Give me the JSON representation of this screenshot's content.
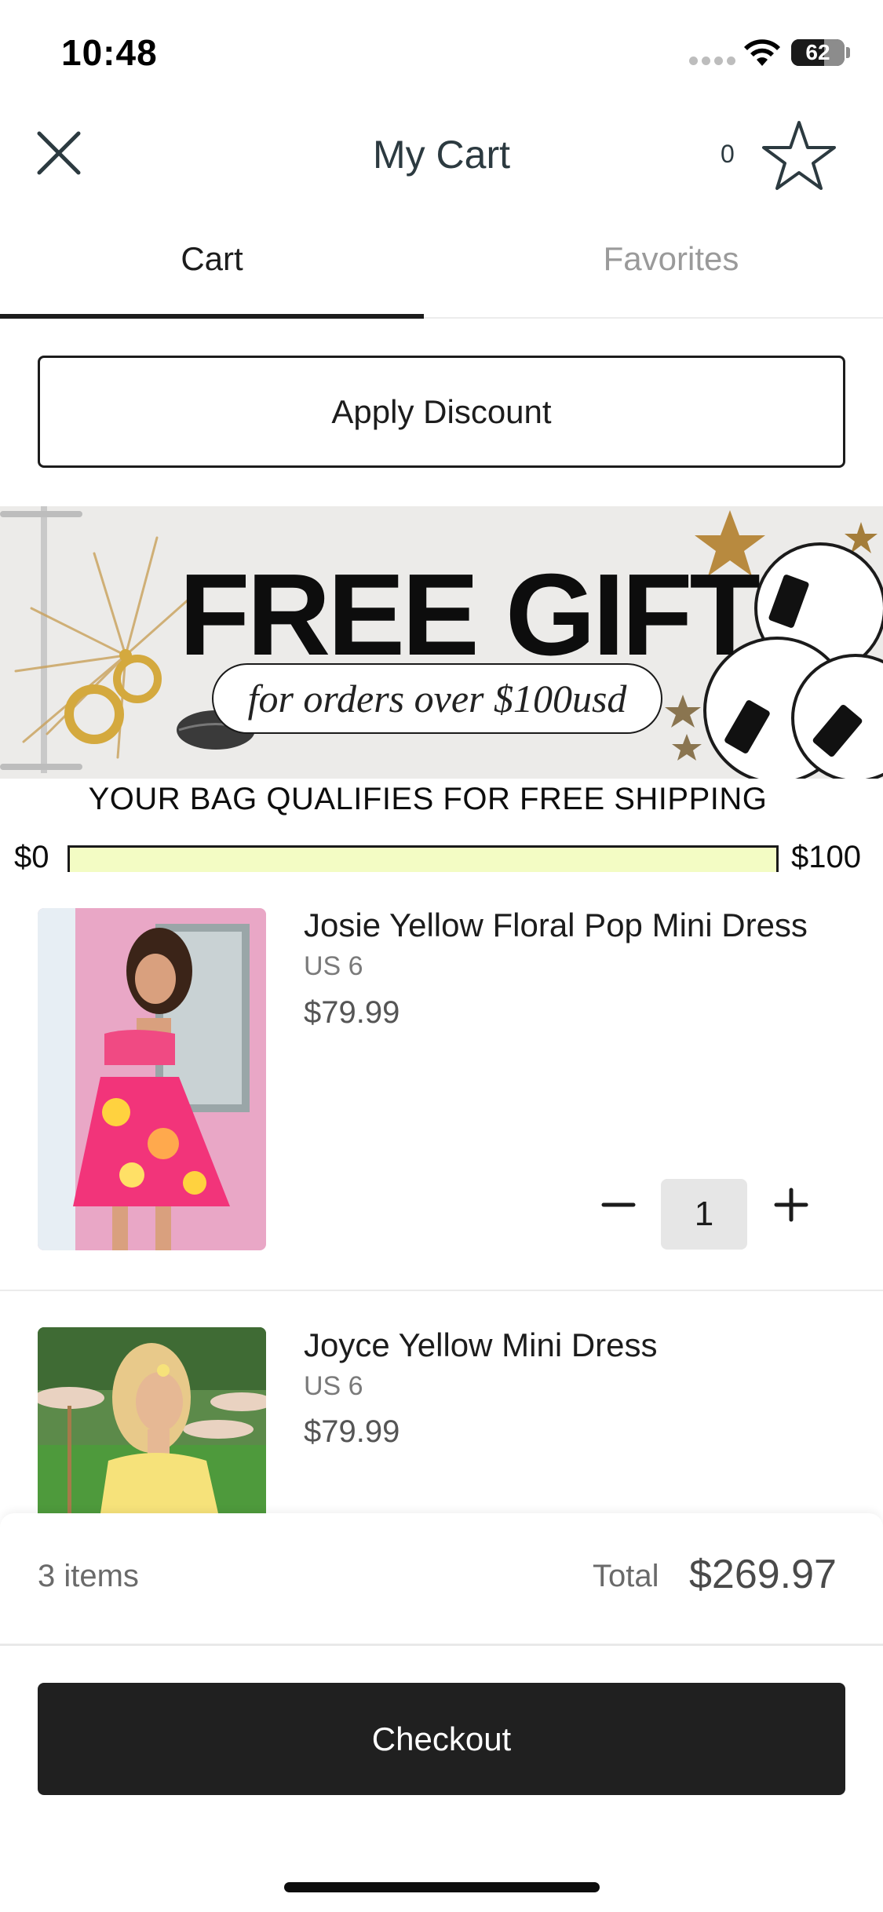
{
  "status_bar": {
    "time": "10:48",
    "battery": "62",
    "battery_level": 0.62
  },
  "header": {
    "title": "My Cart",
    "favorites_count": "0"
  },
  "tabs": [
    {
      "label": "Cart",
      "active": true
    },
    {
      "label": "Favorites",
      "active": false
    }
  ],
  "discount": {
    "label": "Apply Discount"
  },
  "banner": {
    "title": "FREE GIFT",
    "subtitle": "for orders over $100usd"
  },
  "shipping": {
    "message": "YOUR BAG QUALIFIES FOR FREE SHIPPING",
    "min_label": "$0",
    "max_label": "$100",
    "progress": 1.0,
    "bar_color": "#f3fcc4"
  },
  "items": [
    {
      "name": "Josie Yellow Floral Pop Mini Dress",
      "size": "US 6",
      "price": "$79.99",
      "quantity": "1"
    },
    {
      "name": "Joyce Yellow Mini Dress",
      "size": "US 6",
      "price": "$79.99"
    }
  ],
  "footer": {
    "item_count": "3 items",
    "total_label": "Total",
    "total": "$269.97",
    "checkout_label": "Checkout"
  },
  "colors": {
    "accent": "#202020",
    "progress_fill": "#f3fcc4",
    "muted_text": "#9a9a9a"
  }
}
